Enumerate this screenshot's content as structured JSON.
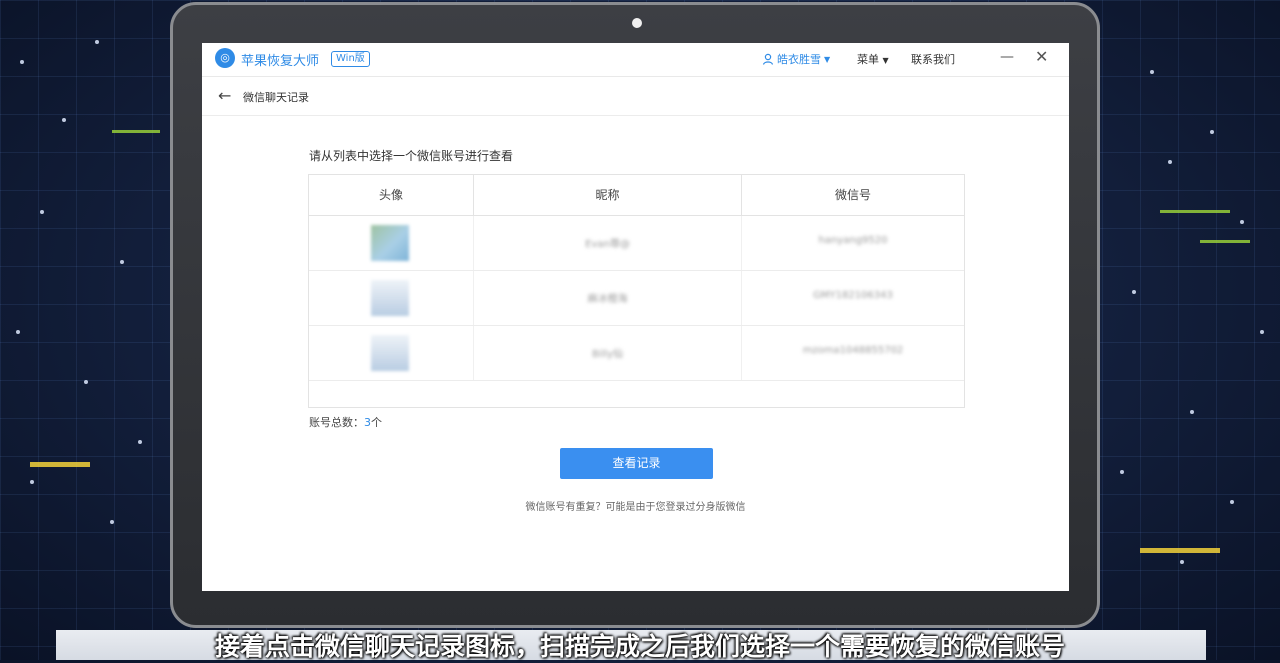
{
  "app": {
    "name": "苹果恢复大师",
    "version_badge": "Win版",
    "user_name": "皓衣胜雪",
    "menu_label": "菜单",
    "contact_label": "联系我们",
    "minimize_glyph": "—",
    "close_glyph": "✕"
  },
  "page": {
    "title": "微信聊天记录",
    "instruction": "请从列表中选择一个微信账号进行查看"
  },
  "table": {
    "headers": [
      "头像",
      "昵称",
      "微信号"
    ],
    "rows": [
      {
        "nickname": "Evan尊@",
        "wechat_id": "hanyang9520"
      },
      {
        "nickname": "麻冰橙海",
        "wechat_id": "GMY182106343"
      },
      {
        "nickname": "Billy仙",
        "wechat_id": "mzoma1048855702"
      }
    ]
  },
  "summary": {
    "label": "账号总数：",
    "count": "3",
    "unit": "个"
  },
  "actions": {
    "view_button": "查看记录"
  },
  "hint": "微信账号有重复？可能是由于您登录过分身版微信",
  "video_subtitle": "接着点击微信聊天记录图标，扫描完成之后我们选择一个需要恢复的微信账号",
  "colors": {
    "accent": "#2f8be6",
    "button": "#3a8ff0"
  }
}
